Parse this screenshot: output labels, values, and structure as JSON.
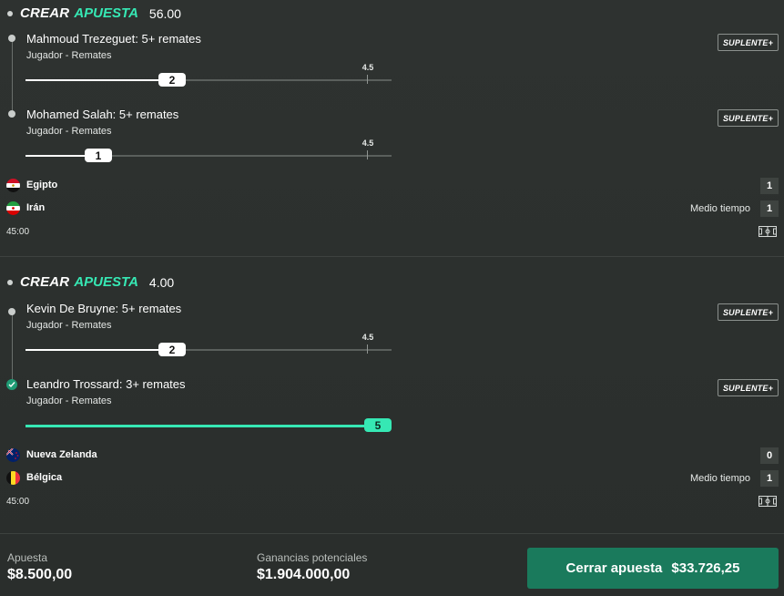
{
  "bets": [
    {
      "header": {
        "crear": "CREAR",
        "apuesta": "APUESTA",
        "odds": "56.00"
      },
      "legs": [
        {
          "title": "Mahmoud Trezeguet: 5+ remates",
          "subtitle": "Jugador - Remates",
          "substitute": "SUPLENTE+",
          "current_value": "2",
          "threshold": "4.5",
          "progress": 0.4,
          "status": "pending"
        },
        {
          "title": "Mohamed Salah: 5+ remates",
          "subtitle": "Jugador - Remates",
          "substitute": "SUPLENTE+",
          "current_value": "1",
          "threshold": "4.5",
          "progress": 0.2,
          "status": "pending"
        }
      ],
      "teams": [
        {
          "name": "Egipto",
          "score": "1",
          "flag": "egypt-flag"
        },
        {
          "name": "Irán",
          "score": "1",
          "flag": "iran-flag"
        }
      ],
      "period": "Medio tiempo",
      "clock": "45:00"
    },
    {
      "header": {
        "crear": "CREAR",
        "apuesta": "APUESTA",
        "odds": "4.00"
      },
      "legs": [
        {
          "title": "Kevin De Bruyne: 5+ remates",
          "subtitle": "Jugador - Remates",
          "substitute": "SUPLENTE+",
          "current_value": "2",
          "threshold": "4.5",
          "progress": 0.4,
          "status": "pending"
        },
        {
          "title": "Leandro Trossard: 3+ remates",
          "subtitle": "Jugador - Remates",
          "substitute": "SUPLENTE+",
          "current_value": "5",
          "threshold": "",
          "progress": 1.0,
          "status": "won"
        }
      ],
      "teams": [
        {
          "name": "Nueva Zelanda",
          "score": "0",
          "flag": "new-zealand-flag"
        },
        {
          "name": "Bélgica",
          "score": "1",
          "flag": "belgium-flag"
        }
      ],
      "period": "Medio tiempo",
      "clock": "45:00"
    }
  ],
  "footer": {
    "stake_label": "Apuesta",
    "stake_value": "$8.500,00",
    "potential_label": "Ganancias potenciales",
    "potential_value": "$1.904.000,00",
    "cashout_label": "Cerrar apuesta",
    "cashout_value": "$33.726,25"
  },
  "colors": {
    "accent": "#36e8b4",
    "cashout_bg": "#1a7a5c",
    "background": "#2b2f2d"
  }
}
